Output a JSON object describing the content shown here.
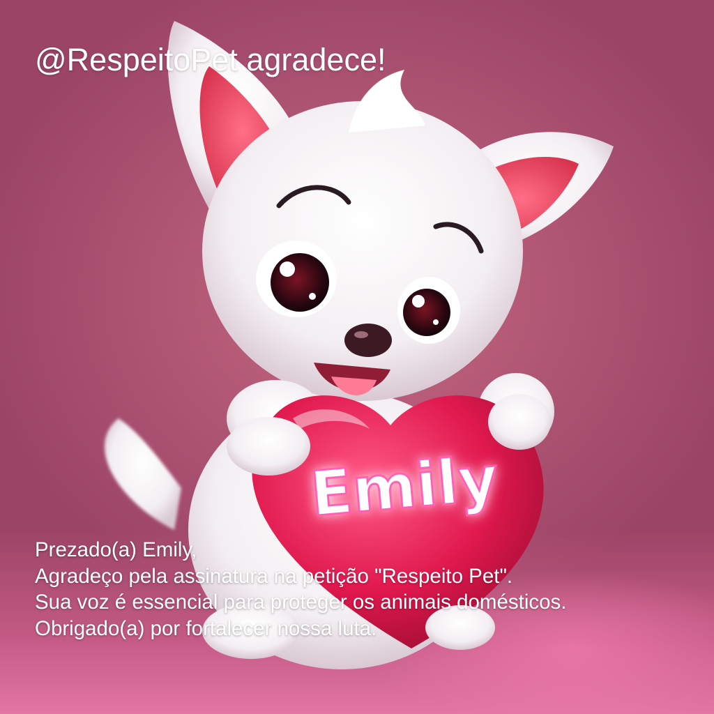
{
  "headline": "@RespeitoPet agradece!",
  "heart_name": "Emily",
  "message": {
    "lines": [
      "Prezado(a) Emily,",
      "Agradeço pela assinatura na petição \"Respeito Pet\".",
      "Sua voz é essencial para proteger os animais domésticos.",
      "Obrigado(a) por fortalecer nossa luta."
    ]
  },
  "colors": {
    "background": "#b5566f",
    "heart": "#e0184e",
    "heart_glow": "#ff5fb4",
    "text": "#ffffff"
  },
  "illustration": "white-puppy-holding-heart"
}
